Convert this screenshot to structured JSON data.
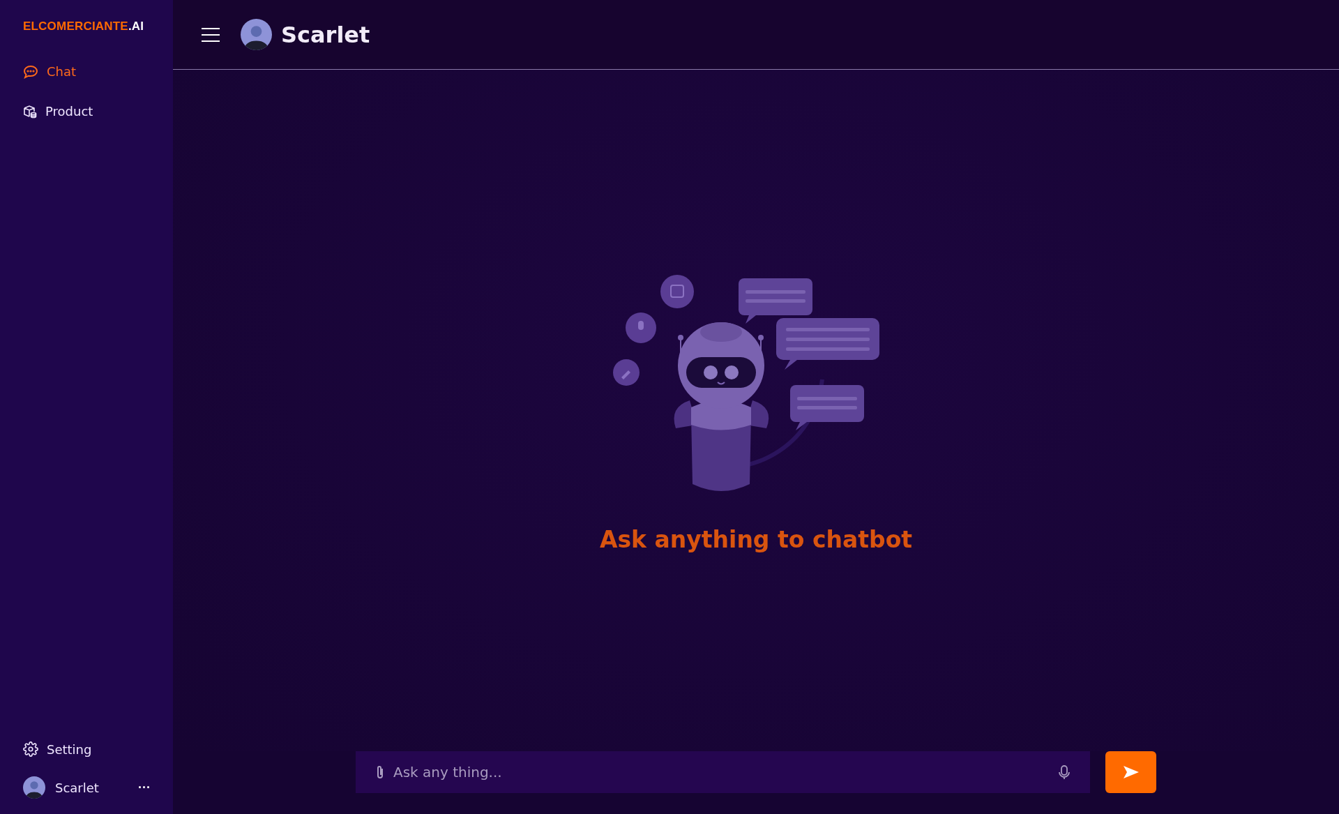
{
  "sidebar": {
    "logo": {
      "brand": "ELCOMERCIANTE",
      "suffix": ".AI"
    },
    "nav": [
      {
        "label": "Chat",
        "kind": "chat",
        "selected": true
      },
      {
        "label": "Product",
        "kind": "product",
        "selected": false
      }
    ],
    "footer": {
      "setting": {
        "label": "Setting"
      },
      "user": {
        "name": "Scarlet",
        "more": "···"
      }
    }
  },
  "header": {
    "title": "Scarlet"
  },
  "empty_state": {
    "heading": "Ask anything to chatbot"
  },
  "composer": {
    "placeholder": "Ask any thing..."
  }
}
